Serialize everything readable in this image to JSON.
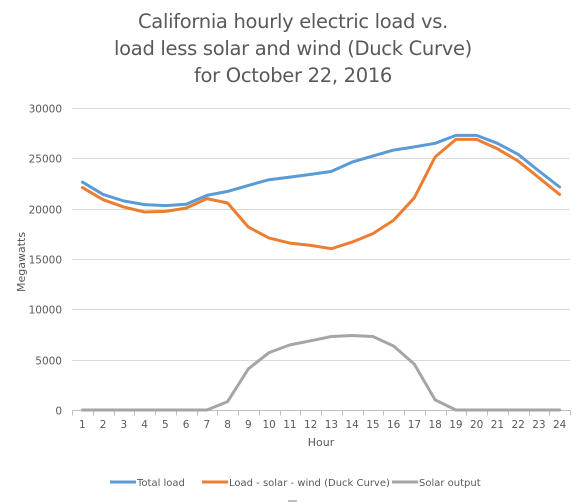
{
  "chart_data": {
    "type": "line",
    "title": [
      "California hourly electric load vs.",
      "load less solar and wind (Duck Curve)",
      "for October 22, 2016"
    ],
    "xlabel": "Hour",
    "ylabel": "Megawatts",
    "ylim": [
      0,
      30000
    ],
    "yticks": [
      0,
      5000,
      10000,
      15000,
      20000,
      25000,
      30000
    ],
    "ytick_labels": [
      "0",
      "5000",
      "10000",
      "15000",
      "20000",
      "25000",
      "30000"
    ],
    "grid": true,
    "legend_position": "bottom",
    "categories": [
      "1",
      "2",
      "3",
      "4",
      "5",
      "6",
      "7",
      "8",
      "9",
      "10",
      "11",
      "12",
      "13",
      "14",
      "15",
      "16",
      "17",
      "18",
      "19",
      "20",
      "21",
      "22",
      "23",
      "24"
    ],
    "series": [
      {
        "name": "Total load",
        "color": "#5B9BD5",
        "values": [
          22640,
          21420,
          20760,
          20400,
          20300,
          20430,
          21320,
          21720,
          22310,
          22880,
          23140,
          23400,
          23700,
          24630,
          25230,
          25820,
          26140,
          26490,
          27280,
          27280,
          26490,
          25400,
          23740,
          22150
        ]
      },
      {
        "name": "Load - solar - wind (Duck Curve)",
        "color": "#ED7D31",
        "values": [
          22090,
          20890,
          20160,
          19670,
          19730,
          20060,
          21000,
          20560,
          18170,
          17080,
          16580,
          16350,
          16020,
          16680,
          17520,
          18840,
          21090,
          25130,
          26880,
          26880,
          25950,
          24740,
          23080,
          21420
        ]
      },
      {
        "name": "Solar output",
        "color": "#A5A5A5",
        "values": [
          0,
          0,
          0,
          0,
          0,
          0,
          0,
          830,
          4090,
          5700,
          6470,
          6870,
          7300,
          7400,
          7300,
          6360,
          4540,
          1000,
          0,
          0,
          0,
          0,
          0,
          0
        ]
      }
    ]
  },
  "colors": {
    "text": "#595959",
    "grid": "#D9D9D9",
    "axis": "#BFBFBF"
  }
}
